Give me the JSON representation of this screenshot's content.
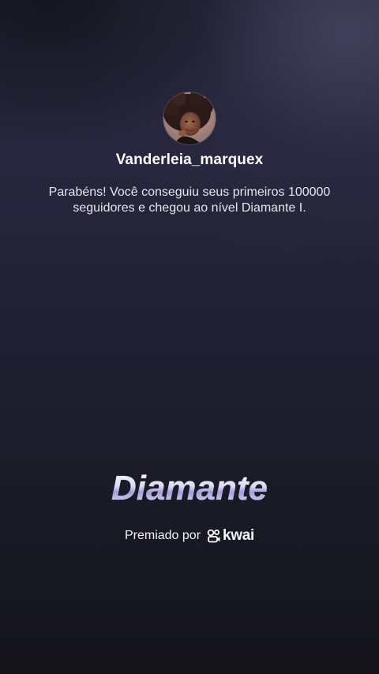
{
  "profile": {
    "username": "Vanderleia_marquex",
    "avatar_icon": "user-photo"
  },
  "message": {
    "text": "Parabéns! Você conseguiu seus primeiros 100000 seguidores e chegou ao nível Diamante I."
  },
  "level": {
    "name": "Diamante"
  },
  "sponsor": {
    "label": "Premiado por",
    "brand": "kwai",
    "brand_icon": "kwai-logo-icon"
  },
  "colors": {
    "background_top": "#27263c",
    "background_bottom": "#141419",
    "text": "#ffffff",
    "level_gradient_light": "#ffffff",
    "level_gradient_purple": "#a49ce0"
  }
}
